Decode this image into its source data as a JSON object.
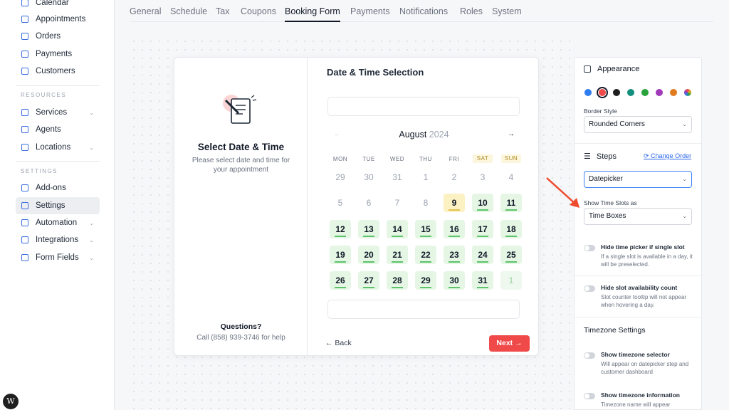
{
  "sidebar": {
    "top_items": [
      {
        "label": "Calendar"
      },
      {
        "label": "Appointments"
      },
      {
        "label": "Orders"
      },
      {
        "label": "Payments"
      },
      {
        "label": "Customers"
      }
    ],
    "resources_label": "RESOURCES",
    "resources_items": [
      {
        "label": "Services",
        "has_chevron": true
      },
      {
        "label": "Agents",
        "has_chevron": false
      },
      {
        "label": "Locations",
        "has_chevron": true
      }
    ],
    "settings_label": "SETTINGS",
    "settings_items": [
      {
        "label": "Add-ons",
        "has_chevron": false
      },
      {
        "label": "Settings",
        "has_chevron": false,
        "active": true
      },
      {
        "label": "Automation",
        "has_chevron": true
      },
      {
        "label": "Integrations",
        "has_chevron": true
      },
      {
        "label": "Form Fields",
        "has_chevron": true
      }
    ],
    "accent": "#3b6fe0"
  },
  "tabs": [
    {
      "label": "General"
    },
    {
      "label": "Schedule"
    },
    {
      "label": "Tax"
    },
    {
      "label": "Coupons"
    },
    {
      "label": "Booking Form",
      "active": true
    },
    {
      "label": "Payments"
    },
    {
      "label": "Notifications"
    },
    {
      "label": "Roles"
    },
    {
      "label": "System"
    }
  ],
  "booking": {
    "left_title": "Select Date & Time",
    "left_desc": "Please select date and time for your appointment",
    "questions_title": "Questions?",
    "questions_call": "Call (858) 939-3746 for help",
    "right_title": "Date & Time Selection",
    "month": "August",
    "year": "2024",
    "prev_symbol": "←",
    "next_symbol": "→",
    "weekdays": [
      "MON",
      "TUE",
      "WED",
      "THU",
      "FRI",
      "SAT",
      "SUN"
    ],
    "weeks": [
      [
        {
          "d": "29",
          "s": "muted"
        },
        {
          "d": "30",
          "s": "muted"
        },
        {
          "d": "31",
          "s": "muted"
        },
        {
          "d": "1",
          "s": "muted"
        },
        {
          "d": "2",
          "s": "muted"
        },
        {
          "d": "3",
          "s": "muted"
        },
        {
          "d": "4",
          "s": "muted"
        }
      ],
      [
        {
          "d": "5",
          "s": "muted"
        },
        {
          "d": "6",
          "s": "muted"
        },
        {
          "d": "7",
          "s": "muted"
        },
        {
          "d": "8",
          "s": "muted"
        },
        {
          "d": "9",
          "s": "selected"
        },
        {
          "d": "10",
          "s": "available"
        },
        {
          "d": "11",
          "s": "available"
        }
      ],
      [
        {
          "d": "12",
          "s": "available"
        },
        {
          "d": "13",
          "s": "available"
        },
        {
          "d": "14",
          "s": "available"
        },
        {
          "d": "15",
          "s": "available"
        },
        {
          "d": "16",
          "s": "available"
        },
        {
          "d": "17",
          "s": "available"
        },
        {
          "d": "18",
          "s": "available"
        }
      ],
      [
        {
          "d": "19",
          "s": "available"
        },
        {
          "d": "20",
          "s": "available"
        },
        {
          "d": "21",
          "s": "available"
        },
        {
          "d": "22",
          "s": "available"
        },
        {
          "d": "23",
          "s": "available"
        },
        {
          "d": "24",
          "s": "available"
        },
        {
          "d": "25",
          "s": "available"
        }
      ],
      [
        {
          "d": "26",
          "s": "available"
        },
        {
          "d": "27",
          "s": "available"
        },
        {
          "d": "28",
          "s": "available"
        },
        {
          "d": "29",
          "s": "available"
        },
        {
          "d": "30",
          "s": "available"
        },
        {
          "d": "31",
          "s": "available"
        },
        {
          "d": "1",
          "s": "next-month"
        }
      ]
    ],
    "back_label": "← Back",
    "next_label": "Next →",
    "next_color": "#ef4949"
  },
  "panel": {
    "appearance_title": "Appearance",
    "swatches": [
      {
        "color": "#2f7df0"
      },
      {
        "color": "#ef4949",
        "selected": true
      },
      {
        "color": "#1f1f1f"
      },
      {
        "color": "#13907d"
      },
      {
        "color": "#29a33c"
      },
      {
        "color": "#a13ab8"
      },
      {
        "color": "#e07b20"
      },
      {
        "color": "#d94dc1",
        "multi": true
      }
    ],
    "border_style_label": "Border Style",
    "border_style_value": "Rounded Corners",
    "steps_title": "Steps",
    "change_order_label": "Change Order",
    "steps_value": "Datepicker",
    "time_slots_label": "Show Time Slots as",
    "time_slots_value": "Time Boxes",
    "toggles": [
      {
        "title": "Hide time picker if single slot",
        "desc": "If a single slot is available in a day, it will be preselected."
      },
      {
        "title": "Hide slot availability count",
        "desc": "Slot counter tooltip will not appear when hovering a day."
      }
    ],
    "timezone_title": "Timezone Settings",
    "tz_toggles": [
      {
        "title": "Show timezone selector",
        "desc": "Will appear on datepicker step and customer dashboard"
      },
      {
        "title": "Show timezone information",
        "desc": "Timezone name will appear"
      }
    ]
  },
  "annotation_color": "#ef4b2e",
  "wp_logo_letter": "W"
}
